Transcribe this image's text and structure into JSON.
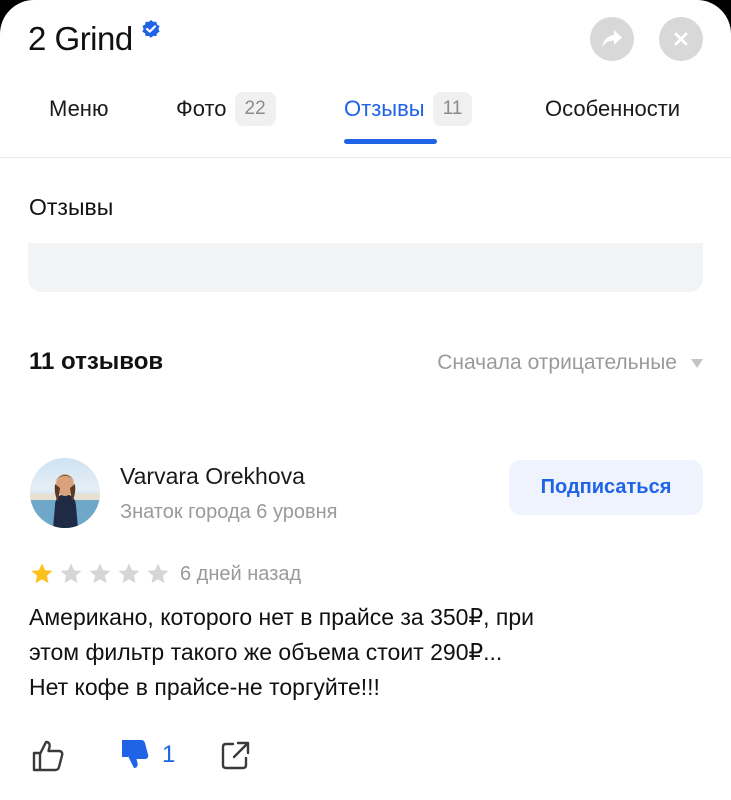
{
  "header": {
    "title": "2 Grind"
  },
  "tabs": [
    {
      "label": "Меню",
      "count": ""
    },
    {
      "label": "Фото",
      "count": "22"
    },
    {
      "label": "Отзывы",
      "count": "11"
    },
    {
      "label": "Особенности",
      "count": ""
    }
  ],
  "active_tab": "Отзывы",
  "section": {
    "title": "Отзывы"
  },
  "reviews_summary": {
    "count_label": "11 отзывов",
    "sort_label": "Сначала отрицательные"
  },
  "review": {
    "author_name": "Varvara Orekhova",
    "author_level": "Знаток города 6 уровня",
    "subscribe_label": "Подписаться",
    "rating": 1,
    "rating_max": 5,
    "date": "6 дней назад",
    "text_lines": [
      "Американо, которого нет в прайсе за 350₽, при",
      "этом фильтр такого же объема стоит 290₽...",
      "Нет кофе в прайсе-не торгуйте!!!"
    ],
    "dislike_count": "1"
  },
  "colors": {
    "accent": "#1f63e6",
    "star_filled": "#fcc21b",
    "star_empty": "#d6d6d6",
    "secondary_text": "#9a9a9a"
  },
  "icons": {
    "verified": "verified-check-icon",
    "share": "share-arrow-icon",
    "close": "close-icon",
    "sort": "caret-down-icon",
    "like": "thumbs-up-icon",
    "dislike": "thumbs-down-icon",
    "share_review": "external-share-icon"
  }
}
